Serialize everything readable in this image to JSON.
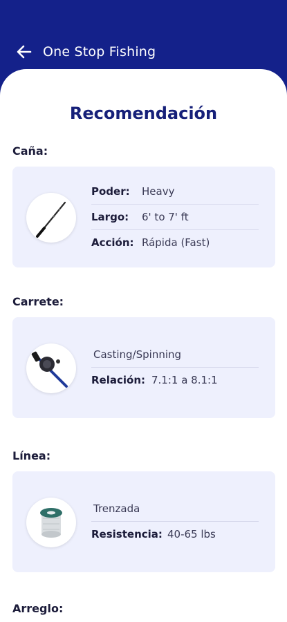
{
  "header": {
    "title": "One Stop Fishing",
    "back_icon": "arrow-left-icon",
    "bg_color": "#14218a"
  },
  "page_title": "Recomendación",
  "sections": {
    "cana": {
      "label": "Caña:",
      "icon": "fishing-rod-icon",
      "rows": [
        {
          "key": "Poder:",
          "value": "Heavy"
        },
        {
          "key": "Largo:",
          "value": "6' to 7' ft"
        },
        {
          "key": "Acción:",
          "value": "Rápida (Fast)"
        }
      ]
    },
    "carrete": {
      "label": "Carrete:",
      "icon": "fishing-reel-icon",
      "type": "Casting/Spinning",
      "rows": [
        {
          "key": "Relación:",
          "value": "7.1:1 a 8.1:1"
        }
      ]
    },
    "linea": {
      "label": "Línea:",
      "icon": "line-spool-icon",
      "type": "Trenzada",
      "rows": [
        {
          "key": "Resistencia:",
          "value": "40-65 lbs"
        }
      ]
    },
    "arreglo": {
      "label": "Arreglo:"
    }
  }
}
